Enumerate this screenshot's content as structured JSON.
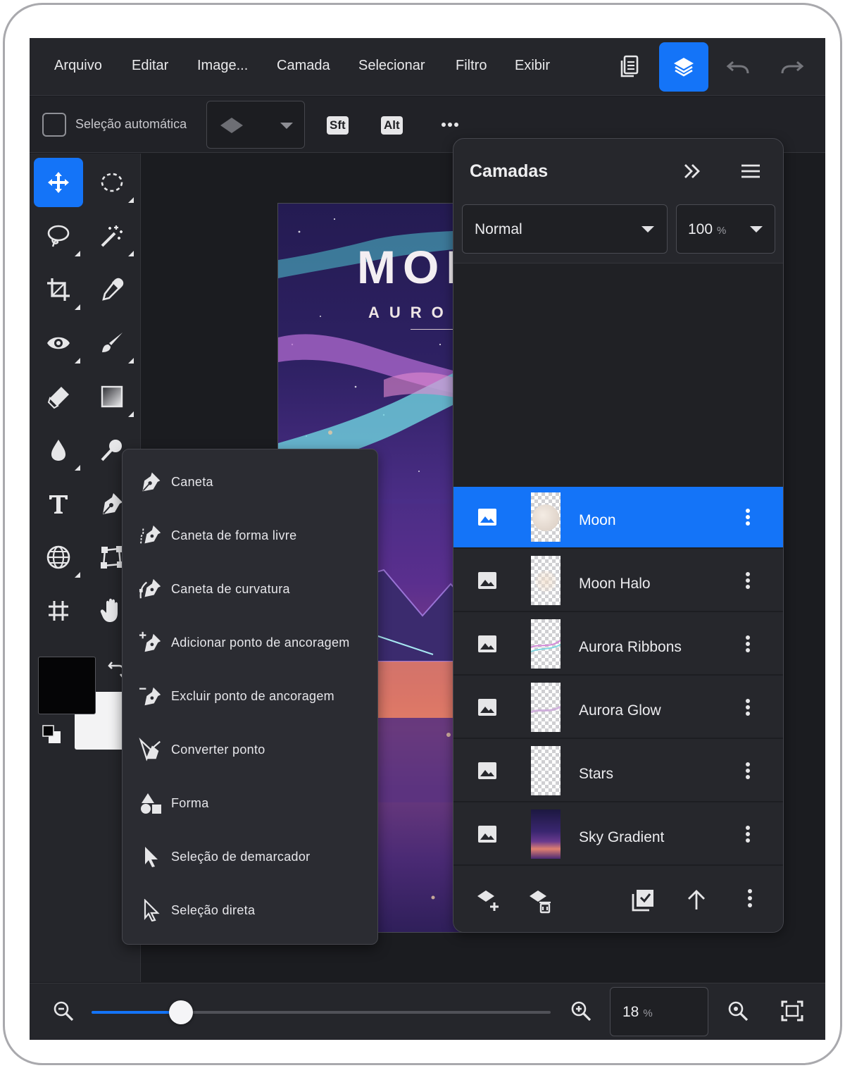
{
  "menubar": {
    "items": [
      "Arquivo",
      "Editar",
      "Image...",
      "Camada",
      "Selecionar",
      "Filtro",
      "Exibir"
    ],
    "buttons": {
      "documents": "documents-icon",
      "layers": "layers-icon",
      "undo": "undo-icon",
      "redo": "redo-icon"
    },
    "accent": "#1474f8"
  },
  "options": {
    "auto_select_label": "Seleção automática",
    "auto_select_checked": false,
    "modifier_shift": "Sft",
    "modifier_alt": "Alt"
  },
  "canvas": {
    "poster_title": "MOE",
    "poster_subtitle": "AURORA"
  },
  "pen_flyout": {
    "items": [
      {
        "label": "Caneta",
        "icon": "pen-icon"
      },
      {
        "label": "Caneta de forma livre",
        "icon": "freeform-pen-icon"
      },
      {
        "label": "Caneta de curvatura",
        "icon": "curvature-pen-icon"
      },
      {
        "label": "Adicionar ponto de ancoragem",
        "icon": "add-anchor-icon"
      },
      {
        "label": "Excluir ponto de ancoragem",
        "icon": "delete-anchor-icon"
      },
      {
        "label": "Converter ponto",
        "icon": "convert-point-icon"
      },
      {
        "label": "Forma",
        "icon": "shape-icon"
      },
      {
        "label": "Seleção de demarcador",
        "icon": "path-selection-icon"
      },
      {
        "label": "Seleção direta",
        "icon": "direct-selection-icon"
      }
    ]
  },
  "layers_panel": {
    "title": "Camadas",
    "blend_mode": "Normal",
    "opacity_value": "100",
    "opacity_unit": "%",
    "layers": [
      {
        "name": "Moon",
        "selected": true
      },
      {
        "name": "Moon Halo",
        "selected": false
      },
      {
        "name": "Aurora Ribbons",
        "selected": false
      },
      {
        "name": "Aurora Glow",
        "selected": false
      },
      {
        "name": "Stars",
        "selected": false
      },
      {
        "name": "Sky Gradient",
        "selected": false
      }
    ]
  },
  "zoom": {
    "value": "18",
    "unit": "%",
    "slider_fraction": 0.195
  },
  "colors": {
    "foreground": "#050506",
    "background": "#f3f3f4"
  }
}
